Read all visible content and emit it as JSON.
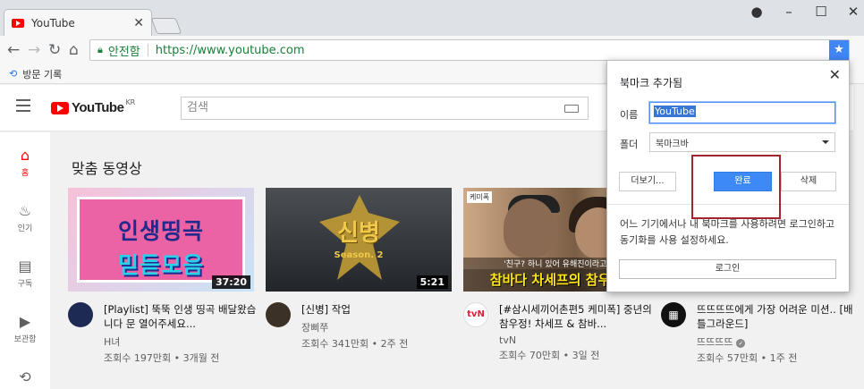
{
  "browser": {
    "tab_title": "YouTube",
    "url": "https://www.youtube.com",
    "secure_label": "안전함",
    "bookmarks_bar_item": "방문 기록"
  },
  "youtube": {
    "logo_text": "YouTube",
    "region": "KR",
    "search_placeholder": "검색",
    "guide": [
      {
        "label": "홈",
        "icon": "home-icon"
      },
      {
        "label": "인기",
        "icon": "fire-icon"
      },
      {
        "label": "구독",
        "icon": "subscriptions-icon"
      },
      {
        "label": "보관함",
        "icon": "library-icon"
      },
      {
        "label": "",
        "icon": "history-icon"
      }
    ],
    "section_title": "맞춤 동영상",
    "videos": [
      {
        "thumb_line1": "인생띵곡",
        "thumb_line2": "믿듣모음",
        "duration": "37:20",
        "title": "[Playlist] 뚝뚝 인생 띵곡 배달왔습니다 문 열어주세요...",
        "channel": "H녀",
        "views": "조회수 197만회 • 3개월 전"
      },
      {
        "thumb_text": "신병",
        "thumb_sub": "Season. 2",
        "duration": "5:21",
        "title": "[신병] 작업",
        "channel": "장삐쭈",
        "views": "조회수 341만회 • 2주 전"
      },
      {
        "thumb_tag": "케미폭",
        "thumb_sub1": "'친구? 하니 있어 유해진이라고'",
        "thumb_sub2": "참바다 차세프의 참우정",
        "title": "[#삼시세끼어촌편5 케미폭] 중년의 참우정! 차세프 & 참바...",
        "channel": "tvN",
        "views": "조회수 70만회 • 3일 전"
      },
      {
        "title": "뜨뜨뜨뜨에게 가장 어려운 미션.. [배틀그라운드]",
        "channel": "뜨뜨뜨뜨",
        "views": "조회수 57만회 • 1주 전"
      }
    ]
  },
  "bookmark_popup": {
    "title": "북마크 추가됨",
    "name_label": "이름",
    "name_value": "YouTube",
    "folder_label": "폴더",
    "folder_value": "북마크바",
    "more_button": "더보기...",
    "done_button": "완료",
    "delete_button": "삭제",
    "sync_note": "어느 기기에서나 내 북마크를 사용하려면 로그인하고 동기화를 사용 설정하세요.",
    "login_button": "로그인"
  },
  "colors": {
    "accent_blue": "#3d8af7",
    "youtube_red": "#ff0000",
    "highlight_box": "#a4232e"
  }
}
